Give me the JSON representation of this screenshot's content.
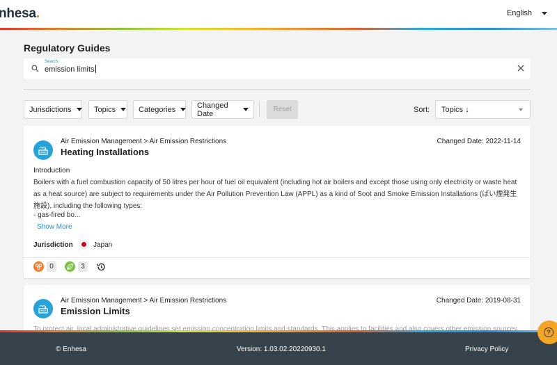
{
  "header": {
    "logo_text": "nhesa",
    "logo_dot": ".",
    "language": "English"
  },
  "page": {
    "title": "Regulatory Guides"
  },
  "search": {
    "label": "Search",
    "value": "emission limits"
  },
  "filters": {
    "jurisdictions": "Jurisdictions",
    "topics": "Topics",
    "categories": "Categories",
    "changed_date": "Changed Date",
    "reset": "Reset",
    "sort_label": "Sort:",
    "sort_value": "Topics ↓"
  },
  "results": [
    {
      "breadcrumb": "Air Emission Management > Air Emission Restrictions",
      "title": "Heating Installations",
      "changed_date": "Changed Date: 2022-11-14",
      "intro_heading": "Introduction",
      "intro_text": "Boilers with a fuel combustion capacity of 50 litres per hour of fuel oil equivalent (including hot air boilers and except those using only electricity or waste heat as a heat source) are subject to requirements under the Air Pollution Prevention Law (APPL) as a kind of Soot and Smoke Emission Installations (ばい煙発生施設), including the following types:",
      "intro_extra": "- gas-fired bo...",
      "show_more": "Show More",
      "jurisdiction_label": "Jurisdiction",
      "jurisdiction": "Japan",
      "stat1_count": "0",
      "stat2_count": "3"
    },
    {
      "breadcrumb": "Air Emission Management > Air Emission Restrictions",
      "title": "Emission Limits",
      "changed_date": "Changed Date: 2019-08-31",
      "partial_text": "To protect air, local administrative guidelines set emission concentration limits and standards. This applies to facilities and also covers other emission sources"
    }
  ],
  "footer": {
    "copyright": "© Enhesa",
    "version": "Version: 1.03.02.20220930.1",
    "privacy": "Privacy Policy"
  },
  "colors": {
    "accent_blue": "#27a3db",
    "link_blue": "#2d8ed6",
    "footer_bg": "#36434d",
    "help_orange": "#f5a524",
    "stat_orange": "#ef7d2f",
    "stat_green": "#7cc242"
  },
  "icons": {
    "search": "search-icon",
    "clear": "close-icon",
    "topic": "factory-emission-icon",
    "stat1": "hub-icon",
    "stat2": "leaf-icon",
    "history": "history-icon",
    "help": "help-icon"
  }
}
